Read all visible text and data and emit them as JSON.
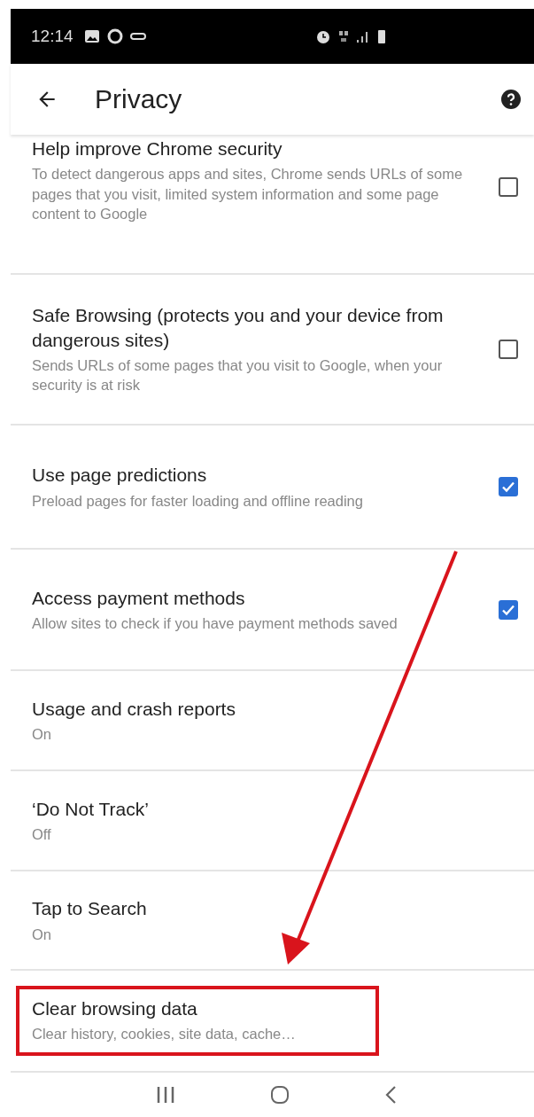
{
  "status_bar": {
    "time": "12:14"
  },
  "app_bar": {
    "title": "Privacy"
  },
  "items": [
    {
      "kind": "checkbox",
      "title": "Help improve Chrome security",
      "summary": "To detect dangerous apps and sites, Chrome sends URLs of some pages that you visit, limited system information and some page content to Google",
      "checked": false,
      "highlighted": false
    },
    {
      "kind": "checkbox",
      "title": "Safe Browsing (protects you and your device from dangerous sites)",
      "summary": "Sends URLs of some pages that you visit to Google, when your security is at risk",
      "checked": false,
      "highlighted": false
    },
    {
      "kind": "checkbox",
      "title": "Use page predictions",
      "summary": "Preload pages for faster loading and offline reading",
      "checked": true,
      "highlighted": false
    },
    {
      "kind": "checkbox",
      "title": "Access payment methods",
      "summary": "Allow sites to check if you have payment methods saved",
      "checked": true,
      "highlighted": false
    },
    {
      "kind": "value",
      "title": "Usage and crash reports",
      "summary": "On",
      "highlighted": false
    },
    {
      "kind": "value",
      "title": "‘Do Not Track’",
      "summary": "Off",
      "highlighted": false
    },
    {
      "kind": "value",
      "title": "Tap to Search",
      "summary": "On",
      "highlighted": false
    },
    {
      "kind": "value",
      "title": "Clear browsing data",
      "summary": "Clear history, cookies, site data, cache…",
      "highlighted": true
    }
  ]
}
